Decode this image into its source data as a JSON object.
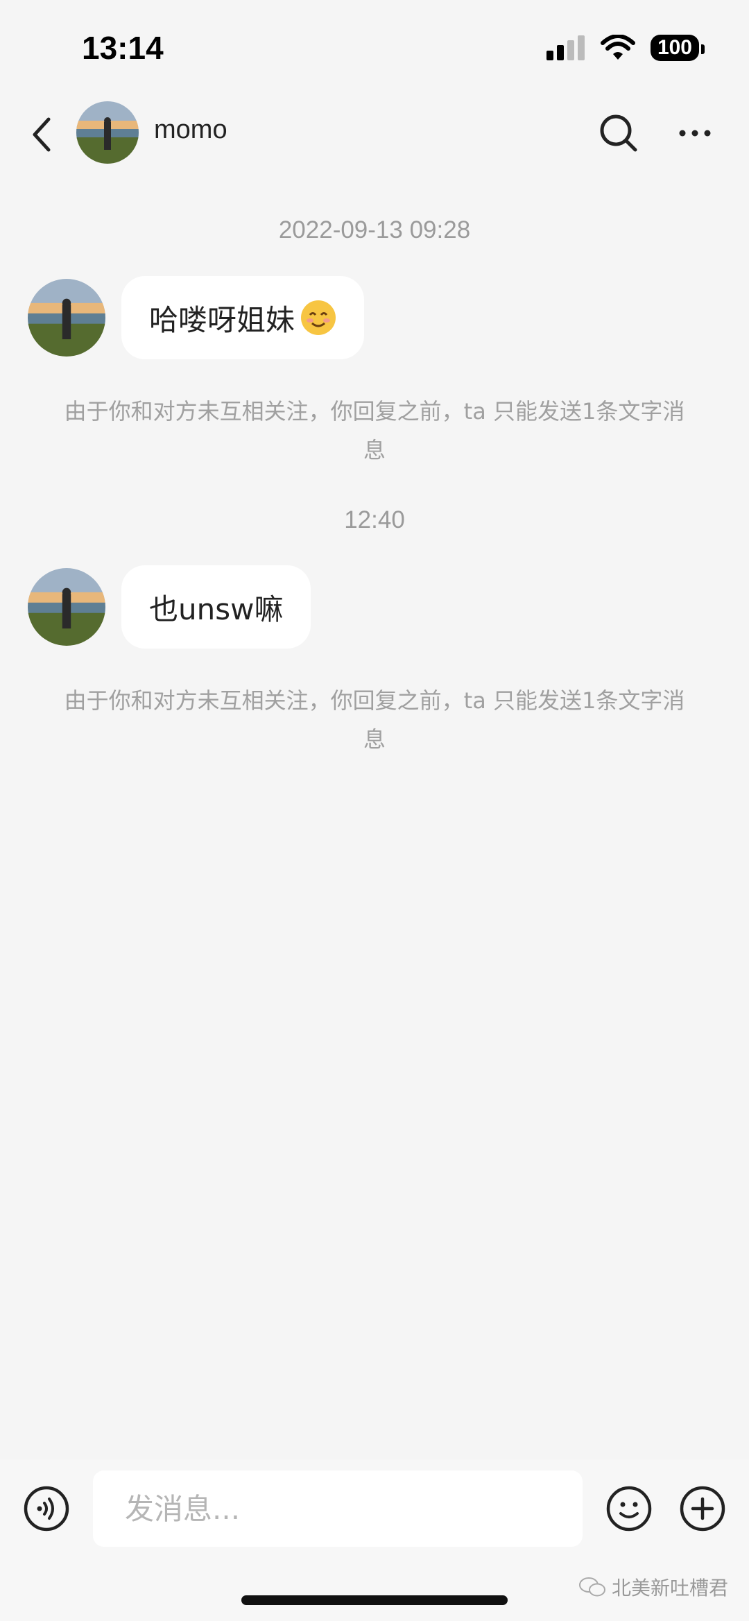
{
  "status_bar": {
    "time": "13:14",
    "battery": "100"
  },
  "header": {
    "contact_name": "momo"
  },
  "messages": [
    {
      "timestamp": "2022-09-13 09:28",
      "text": "哈喽呀姐妹",
      "emoji": "smiling-face-emoji",
      "notice": "由于你和对方未互相关注，你回复之前，ta 只能发送1条文字消息"
    },
    {
      "timestamp": "12:40",
      "text": "也unsw嘛",
      "notice": "由于你和对方未互相关注，你回复之前，ta 只能发送1条文字消息"
    }
  ],
  "input": {
    "placeholder": "发消息..."
  },
  "watermark": "北美新吐槽君",
  "colors": {
    "background": "#f5f5f5",
    "bubble": "#ffffff",
    "timestamp": "#9a9a9a",
    "notice": "#a0a0a0"
  }
}
